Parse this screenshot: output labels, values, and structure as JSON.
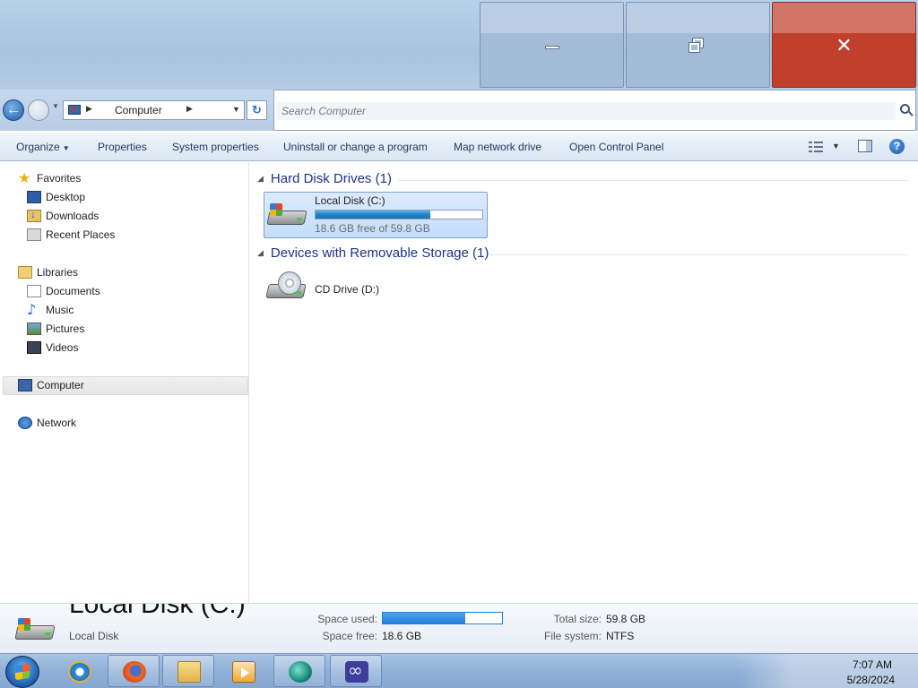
{
  "window": {
    "minimize_glyph": "",
    "close_glyph": "✕"
  },
  "address": {
    "path": "Computer",
    "back_glyph": "←",
    "refresh_glyph": "↻"
  },
  "search": {
    "placeholder": "Search Computer"
  },
  "toolbar": {
    "organize": "Organize",
    "properties": "Properties",
    "system_properties": "System properties",
    "uninstall": "Uninstall or change a program",
    "map_drive": "Map network drive",
    "control_panel": "Open Control Panel",
    "help_glyph": "?"
  },
  "navigation": {
    "favorites": {
      "label": "Favorites",
      "icon": "star-icon"
    },
    "favorites_items": [
      {
        "label": "Desktop",
        "icon": "desktop-icon"
      },
      {
        "label": "Downloads",
        "icon": "downloads-icon"
      },
      {
        "label": "Recent Places",
        "icon": "recent-places-icon"
      }
    ],
    "libraries": {
      "label": "Libraries",
      "icon": "library-icon"
    },
    "libraries_items": [
      {
        "label": "Documents",
        "icon": "documents-icon"
      },
      {
        "label": "Music",
        "icon": "music-icon"
      },
      {
        "label": "Pictures",
        "icon": "pictures-icon"
      },
      {
        "label": "Videos",
        "icon": "videos-icon"
      }
    ],
    "computer": {
      "label": "Computer",
      "icon": "computer-icon"
    },
    "network": {
      "label": "Network",
      "icon": "network-icon"
    }
  },
  "content": {
    "hdd_group": "Hard Disk Drives (1)",
    "removable_group": "Devices with Removable Storage (1)",
    "local_disk": {
      "name": "Local Disk (C:)",
      "free_text": "18.6 GB free of 59.8 GB",
      "used_fraction": 0.69
    },
    "cd_drive": {
      "name": "CD Drive (D:)"
    }
  },
  "details": {
    "title": "Local Disk (C:)",
    "type": "Local Disk",
    "space_used_label": "Space used:",
    "space_free_label": "Space free:",
    "space_free": "18.6 GB",
    "total_size_label": "Total size:",
    "total_size": "59.8 GB",
    "file_system_label": "File system:",
    "file_system": "NTFS",
    "used_fraction": 0.69
  },
  "taskbar": {
    "time": "7:07 AM",
    "date": "5/28/2024",
    "apps": [
      "internet-explorer-icon",
      "firefox-icon",
      "file-explorer-icon",
      "media-player-icon",
      "media-app-icon",
      "infinity-app-icon"
    ]
  },
  "colors": {
    "accent": "#1e3287",
    "close": "#c1402c",
    "progress": "#1f84c9"
  }
}
